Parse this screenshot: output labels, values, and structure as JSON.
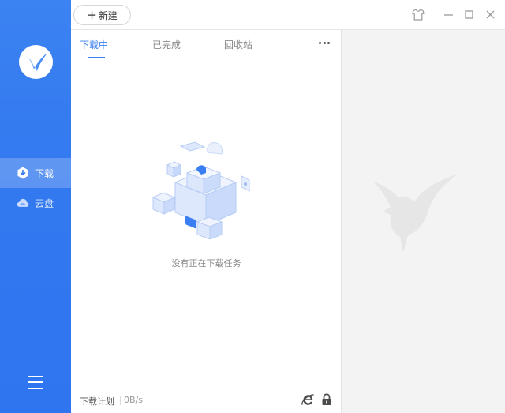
{
  "sidebar": {
    "items": [
      {
        "label": "下载",
        "icon": "download-icon",
        "active": true
      },
      {
        "label": "云盘",
        "icon": "cloud-icon",
        "active": false
      }
    ],
    "menu_icon": "menu-icon",
    "logo_icon": "hummingbird-logo-icon"
  },
  "toolbar": {
    "new_label": "新建",
    "new_icon": "plus-icon",
    "window_controls": [
      "skin-icon",
      "minimize-icon",
      "maximize-icon",
      "close-icon"
    ]
  },
  "tabs": [
    {
      "label": "下载中",
      "active": true
    },
    {
      "label": "已完成",
      "active": false
    },
    {
      "label": "回收站",
      "active": false
    }
  ],
  "empty_state": {
    "message": "没有正在下载任务",
    "illustration": "empty-boxes-illustration"
  },
  "footer": {
    "plan_label": "下载计划",
    "speed": "0B/s",
    "icons": [
      "ie-browser-icon",
      "lock-icon"
    ]
  },
  "colors": {
    "accent": "#3a7ef1",
    "sidebar": "#3278ef",
    "detail_background": "#f3f3f3"
  }
}
